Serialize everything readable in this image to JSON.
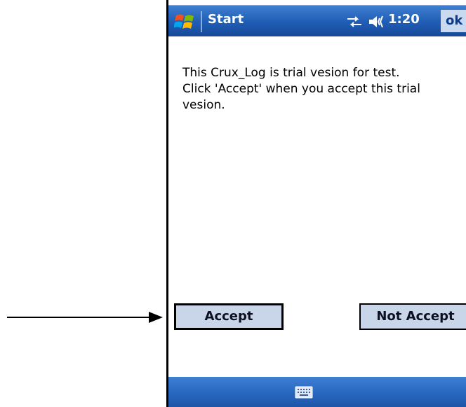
{
  "title_bar": {
    "title": "Start",
    "time": "1:20",
    "ok_label": "ok",
    "icons": [
      "windows-logo-icon",
      "connectivity-icon",
      "volume-icon"
    ]
  },
  "message": {
    "lines": [
      "This Crux_Log is trial vesion for test.",
      "Click 'Accept' when you accept this trial",
      "vesion."
    ]
  },
  "buttons": {
    "accept_label": "Accept",
    "not_accept_label": "Not Accept"
  },
  "bottom_bar": {
    "icons": [
      "keyboard-icon"
    ]
  },
  "colors": {
    "title_bar": "#1f5db4",
    "button_fill": "#c9d6ea",
    "ok_fill": "#c9d9f0"
  }
}
